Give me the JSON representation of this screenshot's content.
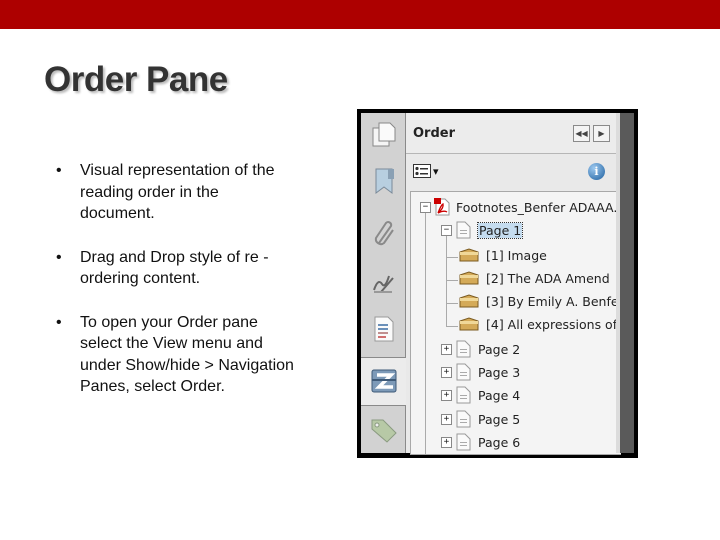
{
  "slide": {
    "title": "Order Pane",
    "bullets": [
      "Visual representation of the reading order in the document.",
      "Drag and Drop style of re -ordering content.",
      "To open your Order pane select the View menu and under Show/hide > Navigation Panes, select Order."
    ],
    "bullet_glyph": "•"
  },
  "panel": {
    "sidebar_icons": [
      "pages-icon",
      "bookmarks-icon",
      "attachments-icon",
      "signatures-icon",
      "content-icon",
      "order-icon",
      "tags-icon"
    ],
    "active_sidebar": "order-icon",
    "header": {
      "title": "Order",
      "collapse_label": "◀◀",
      "expand_label": "▶"
    },
    "toolbar": {
      "options_dropdown_arrow": "▾",
      "info_label": "i"
    },
    "tree": {
      "document": "Footnotes_Benfer ADAAA.p",
      "pages": [
        {
          "label": "Page 1",
          "expanded": true,
          "selected": true,
          "items": [
            "[1]  Image",
            "[2]  The ADA Amend",
            "[3]  By Emily A. Benfe",
            "[4]  All expressions of"
          ]
        },
        {
          "label": "Page 2",
          "expanded": false
        },
        {
          "label": "Page 3",
          "expanded": false
        },
        {
          "label": "Page 4",
          "expanded": false
        },
        {
          "label": "Page 5",
          "expanded": false
        },
        {
          "label": "Page 6",
          "expanded": false
        }
      ],
      "expand_glyph": "+",
      "collapse_glyph": "−"
    }
  },
  "colors": {
    "top_bar": "#ad0000",
    "title_text": "#333333",
    "selection": "#c5dcef"
  }
}
